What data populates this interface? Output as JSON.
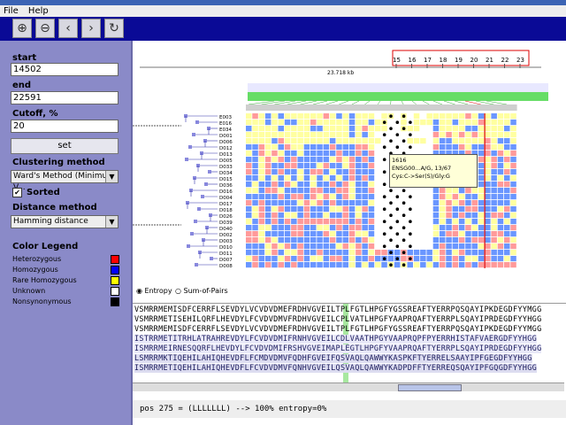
{
  "menu": [
    "File",
    "Help"
  ],
  "toolbar": {
    "icons": [
      "zoom-in-icon",
      "zoom-out-icon",
      "back-icon",
      "forward-icon",
      "refresh-icon"
    ]
  },
  "left": {
    "start_label": "start",
    "start_value": "14502",
    "end_label": "end",
    "end_value": "22591",
    "cutoff_label": "Cutoff, %",
    "cutoff_value": "20",
    "set_button": "set",
    "clustering_label": "Clustering method",
    "clustering_value": "Ward's Method (Minimum V...",
    "sorted_label": "Sorted",
    "distance_label": "Distance method",
    "distance_value": "Hamming distance",
    "legend_title": "Color Legend",
    "legend": [
      {
        "label": "Heterozygous",
        "color": "#ff0000"
      },
      {
        "label": "Homozygous",
        "color": "#0000ff"
      },
      {
        "label": "Rare Homozygous",
        "color": "#ffff00"
      },
      {
        "label": "Unknown",
        "color": "#ffffff"
      },
      {
        "label": "Nonsynonymous",
        "color": "#000000"
      }
    ]
  },
  "ruler": {
    "ticks": [
      "15",
      "16",
      "17",
      "18",
      "19",
      "20",
      "21",
      "22",
      "23"
    ],
    "unit": "23.718 kb"
  },
  "samples": [
    "E003",
    "E016",
    "E034",
    "D001",
    "D006",
    "D012",
    "D013",
    "D005",
    "D033",
    "D034",
    "D015",
    "D036",
    "D016",
    "D004",
    "D017",
    "D018",
    "D026",
    "D039",
    "D040",
    "D002",
    "D003",
    "D010",
    "D011",
    "D007",
    "D008"
  ],
  "tooltip": [
    "1616",
    "ENSG00...A/G, 13/67",
    "Cys:C->Ser(S)/Gly:G"
  ],
  "radio": {
    "entropy": "Entropy",
    "sum_pairs": "Sum-of-Pairs"
  },
  "sequences": [
    "VSMRRMEMISDFCERRFLSEVDYLVCVDVDMEFRDHVGVEILTPLFGTLHPGFYGSSREAFTYERRPQSQAYIPKDEGDFYYMGG",
    "VSMRRMETISEHILQRFLHEVDYLFCVDVDMVFRDHVGVEILCPLVATLHPGFYAAPRQAFTYERRPLSQAYIPRDEGDFYYHGG",
    "VSMRRMEMISDFCERRFLSEVDYLVCVDVDMEFRDHVGVEILTPLFGTLHPGFYGSSREAFTYERRPQSQAYIPKDEGDFYYMGG",
    "ISTRRMETITRHLATRAHREVDYLFCVDVDMIFRNHVGVEILCDLVAATHPGYVAAPRQPFPYERRHISTAFVAERGDFYYHGG",
    "ISMRRMEIRNESQQRFLHEVDYLFCVDVDMIFRSHVGVEIMAPLEGTLHPGFYVAAPRQAFTYERRPLSQAYIPRDEGDFYYHGG",
    "LSMRRMKTIQEHILAHIQHEVDFLFCMDVDMVFQDHFGVEIFQSVAQLQAWWYKASPKFTYERRELSAAYIPFGEGDFYYHGG",
    "ISMRRMETIQEHILAHIQHEVDFLFCVDVDMVFQNHVGVEILQSVAQLQAWWYKADPDFFTYERREQSQAYIPFGQGDFYYHGG"
  ],
  "status": "pos 275 = (LLLLLLL) --> 100% entropy=0%"
}
